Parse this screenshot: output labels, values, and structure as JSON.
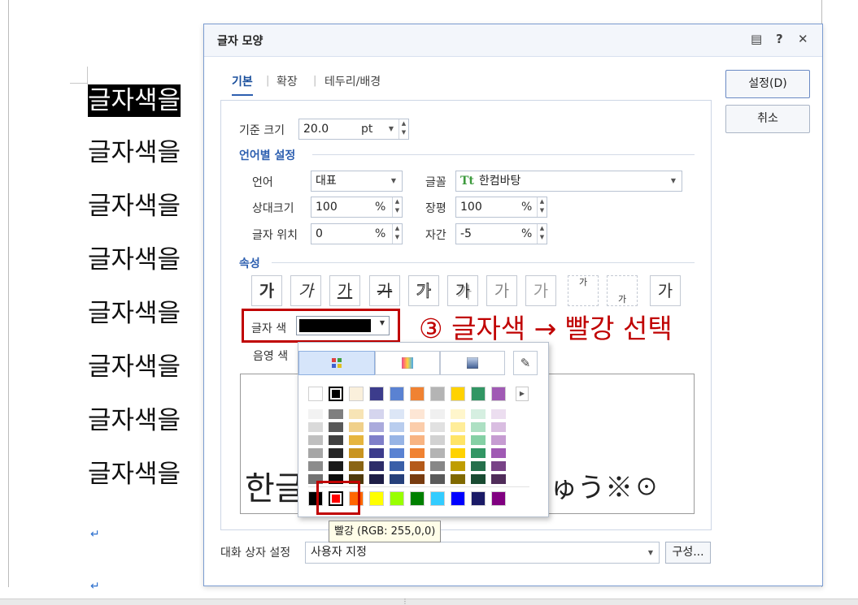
{
  "document": {
    "lines": [
      "글자색을",
      "글자색을",
      "글자색을",
      "글자색을",
      "글자색을",
      "글자색을",
      "글자색을",
      "글자색을"
    ],
    "para_mark": "↵"
  },
  "dialog": {
    "title": "글자 모양",
    "title_buttons": {
      "help_icon": "?",
      "close_icon": "✕",
      "comment_icon": "▤"
    },
    "tabs": [
      "기본",
      "확장",
      "테두리/배경"
    ],
    "base_size": {
      "label": "기준 크기",
      "value": "20.0",
      "unit": "pt"
    },
    "lang_section": "언어별 설정",
    "language": {
      "label": "언어",
      "value": "대표"
    },
    "font": {
      "label": "글꼴",
      "value": "한컴바탕",
      "icon": "Tt"
    },
    "rel_size": {
      "label": "상대크기",
      "value": "100",
      "unit": "%"
    },
    "width": {
      "label": "장평",
      "value": "100",
      "unit": "%"
    },
    "position": {
      "label": "글자 위치",
      "value": "0",
      "unit": "%"
    },
    "spacing": {
      "label": "자간",
      "value": "-5",
      "unit": "%"
    },
    "attr_section": "속성",
    "attr_buttons": [
      "가",
      "가",
      "가",
      "가",
      "가",
      "가",
      "가",
      "가",
      "가",
      "가",
      "가"
    ],
    "attr_names": [
      "bold",
      "italic",
      "underline",
      "strikethrough",
      "outline",
      "shadow",
      "emboss",
      "engrave",
      "superscript",
      "subscript",
      "normal"
    ],
    "text_color": {
      "label": "글자 색",
      "value": "#000000"
    },
    "shade_color": {
      "label": "음영 색"
    },
    "preview_text": "한글",
    "preview_tail": "ゅう※☉",
    "ok_label": "설정(D)",
    "cancel_label": "취소",
    "dialog_setting": {
      "label": "대화 상자 설정",
      "value": "사용자 지정"
    },
    "config_label": "구성..."
  },
  "annotation": "③ 글자색 → 빨강 선택",
  "palette": {
    "top_row": [
      "#ffffff",
      "#000000",
      "#faf0dc",
      "#3c3c8c",
      "#5a82d2",
      "#f08232",
      "#b4b4b4",
      "#ffd200",
      "#329664",
      "#a05ab4"
    ],
    "shade_columns": [
      [
        "#f2f2f2",
        "#d9d9d9",
        "#bfbfbf",
        "#a6a6a6",
        "#8c8c8c",
        "#737373"
      ],
      [
        "#7f7f7f",
        "#595959",
        "#404040",
        "#262626",
        "#1a1a1a",
        "#0d0d0d"
      ],
      [
        "#f7e4b5",
        "#f0d08a",
        "#e6b53e",
        "#c99420",
        "#8a6514",
        "#4f3a0c"
      ],
      [
        "#d5d5ee",
        "#aaaadc",
        "#7f7fc9",
        "#3c3c8c",
        "#2d2d69",
        "#1e1e46"
      ],
      [
        "#dce6f6",
        "#b9cdee",
        "#97b4e5",
        "#5a82d2",
        "#3a5fa8",
        "#26407a"
      ],
      [
        "#fde6d5",
        "#fbcdab",
        "#f8b482",
        "#f08232",
        "#b45a1a",
        "#783c10"
      ],
      [
        "#f0f0f0",
        "#e1e1e1",
        "#d2d2d2",
        "#b4b4b4",
        "#878787",
        "#5a5a5a"
      ],
      [
        "#fff6cc",
        "#ffed99",
        "#ffe466",
        "#ffd200",
        "#bf9d00",
        "#806900"
      ],
      [
        "#d6efe1",
        "#ade0c3",
        "#85d0a5",
        "#329664",
        "#25704b",
        "#194b32"
      ],
      [
        "#ecdef0",
        "#d9bde1",
        "#c69cd2",
        "#a05ab4",
        "#784387",
        "#502d5a"
      ]
    ],
    "bottom_row": [
      "#000000",
      "#ff0000",
      "#ff6600",
      "#ffff00",
      "#99ff00",
      "#008000",
      "#33ccff",
      "#0000ff",
      "#1a1a66",
      "#800080"
    ],
    "selected_index": 1
  },
  "tooltip": "빨강 (RGB: 255,0,0)"
}
